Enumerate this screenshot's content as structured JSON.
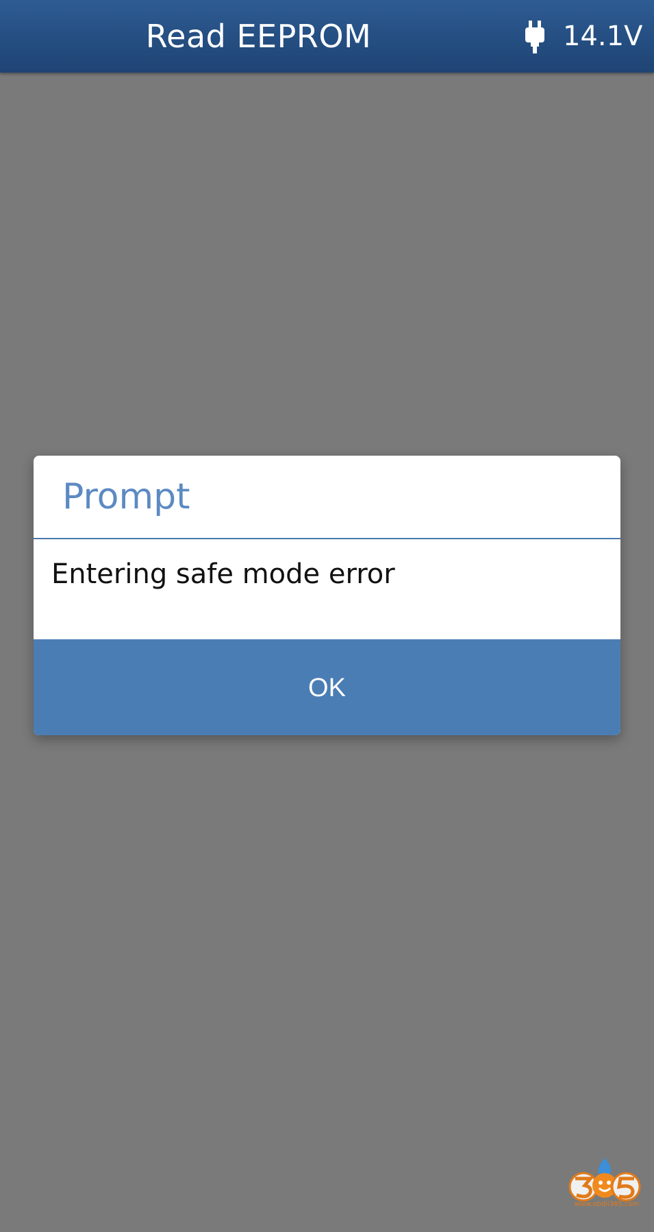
{
  "header": {
    "title": "Read EEPROM",
    "voltage": "14.1V",
    "plug_icon": "plug-icon"
  },
  "dialog": {
    "title": "Prompt",
    "message": "Entering safe mode error",
    "ok_label": "OK"
  },
  "watermark": {
    "logo": "305",
    "url": "www.obdii365.com"
  },
  "colors": {
    "header": "#244d80",
    "background": "#7a7a7a",
    "dialog_title": "#5c8ac2",
    "button": "#4a7db4"
  }
}
